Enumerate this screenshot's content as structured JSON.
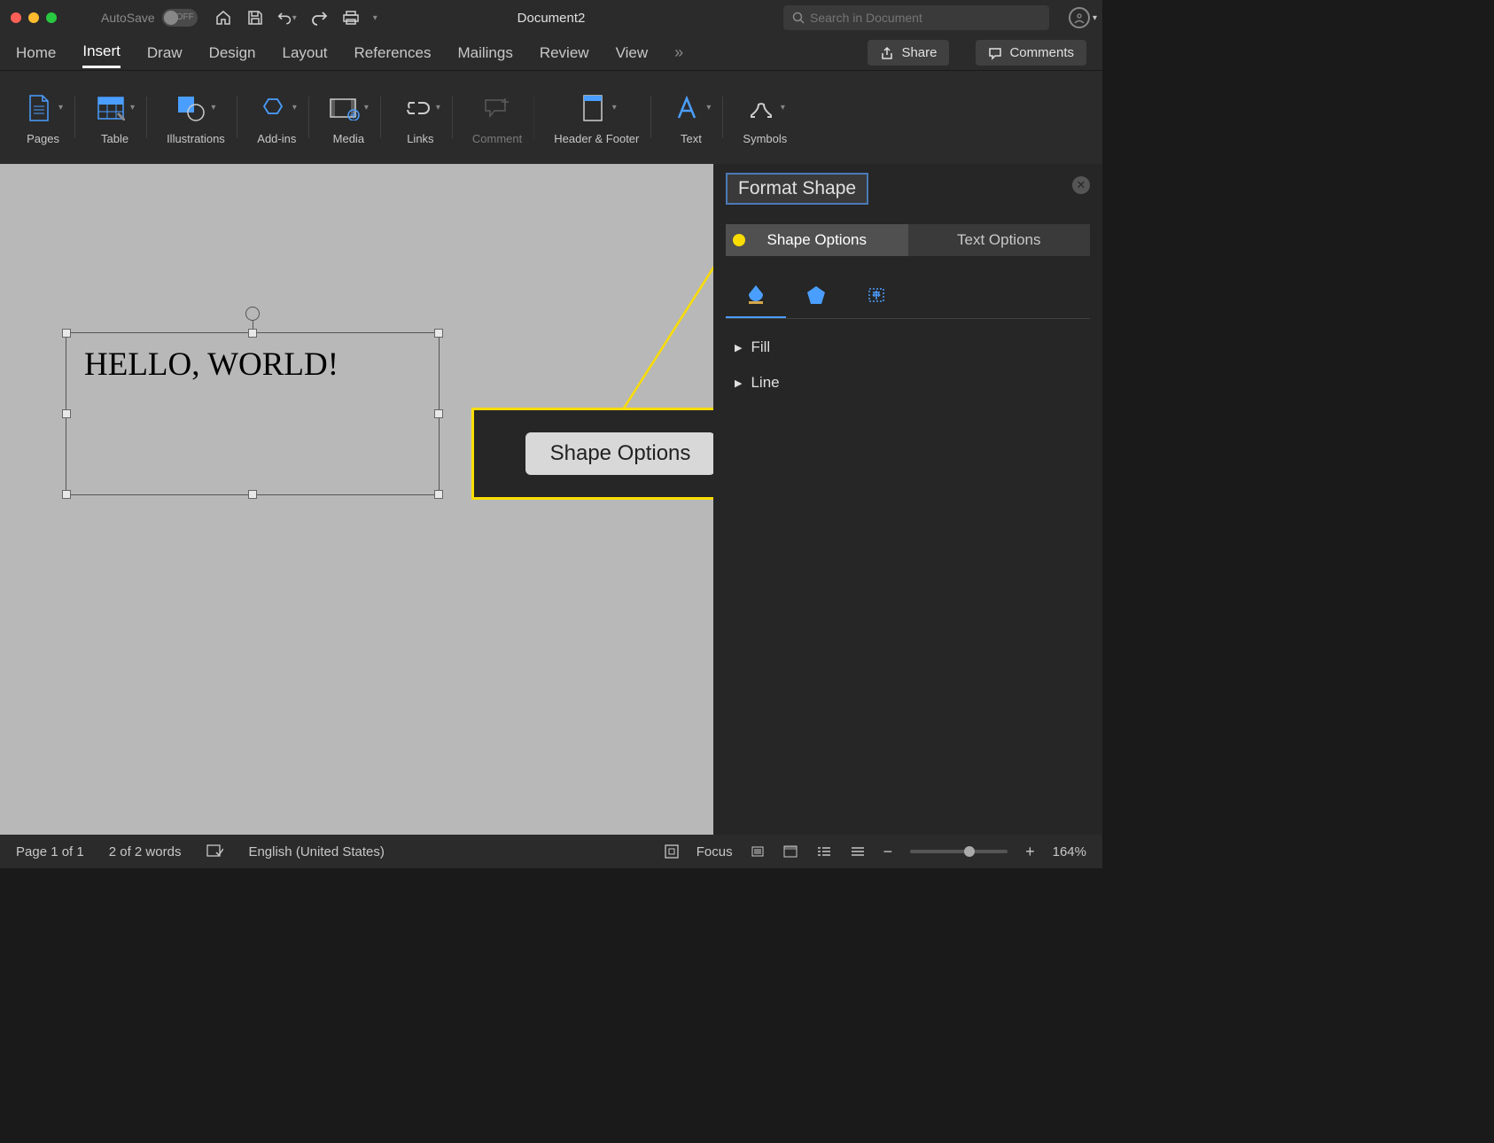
{
  "titlebar": {
    "autosave_label": "AutoSave",
    "autosave_state": "OFF",
    "doc_title": "Document2",
    "search_placeholder": "Search in Document"
  },
  "tabs": {
    "items": [
      "Home",
      "Insert",
      "Draw",
      "Design",
      "Layout",
      "References",
      "Mailings",
      "Review",
      "View"
    ],
    "active_index": 1,
    "share": "Share",
    "comments": "Comments"
  },
  "ribbon": {
    "groups": [
      {
        "label": "Pages"
      },
      {
        "label": "Table"
      },
      {
        "label": "Illustrations"
      },
      {
        "label": "Add-ins"
      },
      {
        "label": "Media"
      },
      {
        "label": "Links"
      },
      {
        "label": "Comment"
      },
      {
        "label": "Header & Footer"
      },
      {
        "label": "Text"
      },
      {
        "label": "Symbols"
      }
    ]
  },
  "canvas": {
    "textbox_text": "HELLO, WORLD!"
  },
  "callout": {
    "label": "Shape Options"
  },
  "panel": {
    "title": "Format Shape",
    "tab_shape": "Shape Options",
    "tab_text": "Text Options",
    "sections": [
      "Fill",
      "Line"
    ]
  },
  "statusbar": {
    "page": "Page 1 of 1",
    "words": "2 of 2 words",
    "lang": "English (United States)",
    "focus": "Focus",
    "zoom": "164%"
  }
}
